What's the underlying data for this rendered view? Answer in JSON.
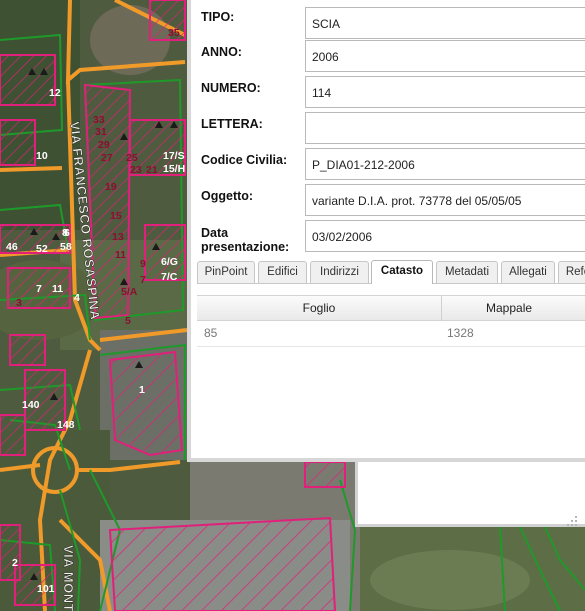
{
  "map": {
    "street_labels": [
      "VIA FRANCESCO ROSASPINA",
      "VIA MONTE"
    ],
    "parcel_numbers": [
      "35",
      "12",
      "10",
      "33",
      "31",
      "29",
      "27",
      "25",
      "23",
      "21",
      "19",
      "17/S",
      "15/H",
      "15",
      "13",
      "11",
      "9",
      "7",
      "6/G",
      "7/C",
      "5/A",
      "5",
      "46",
      "52",
      "58",
      "6",
      "7",
      "11",
      "4",
      "3",
      "1",
      "140",
      "148",
      "2",
      "101",
      "8"
    ]
  },
  "panel": {
    "fields": [
      {
        "label": "TIPO:",
        "value": "SCIA"
      },
      {
        "label": "ANNO:",
        "value": "2006"
      },
      {
        "label": "NUMERO:",
        "value": "114"
      },
      {
        "label": "LETTERA:",
        "value": ""
      },
      {
        "label": "Codice Civilia:",
        "value": "P_DIA01-212-2006"
      },
      {
        "label": "Oggetto:",
        "value": "variante D.I.A. prot. 73778 del 05/05/05"
      },
      {
        "label": "Data presentazione:",
        "value": "03/02/2006"
      }
    ],
    "tabs": [
      "PinPoint",
      "Edifici",
      "Indirizzi",
      "Catasto",
      "Metadati",
      "Allegati",
      "Refe"
    ],
    "active_tab": "Catasto",
    "grid": {
      "columns": [
        "Foglio",
        "Mappale"
      ],
      "rows": [
        [
          "85",
          "1328"
        ]
      ]
    }
  },
  "colors": {
    "parcel_outline": "#e0207a",
    "road_outline": "#f09a2a",
    "boundary_green": "#1e9a2a",
    "panel_border": "#d7d7d7"
  }
}
